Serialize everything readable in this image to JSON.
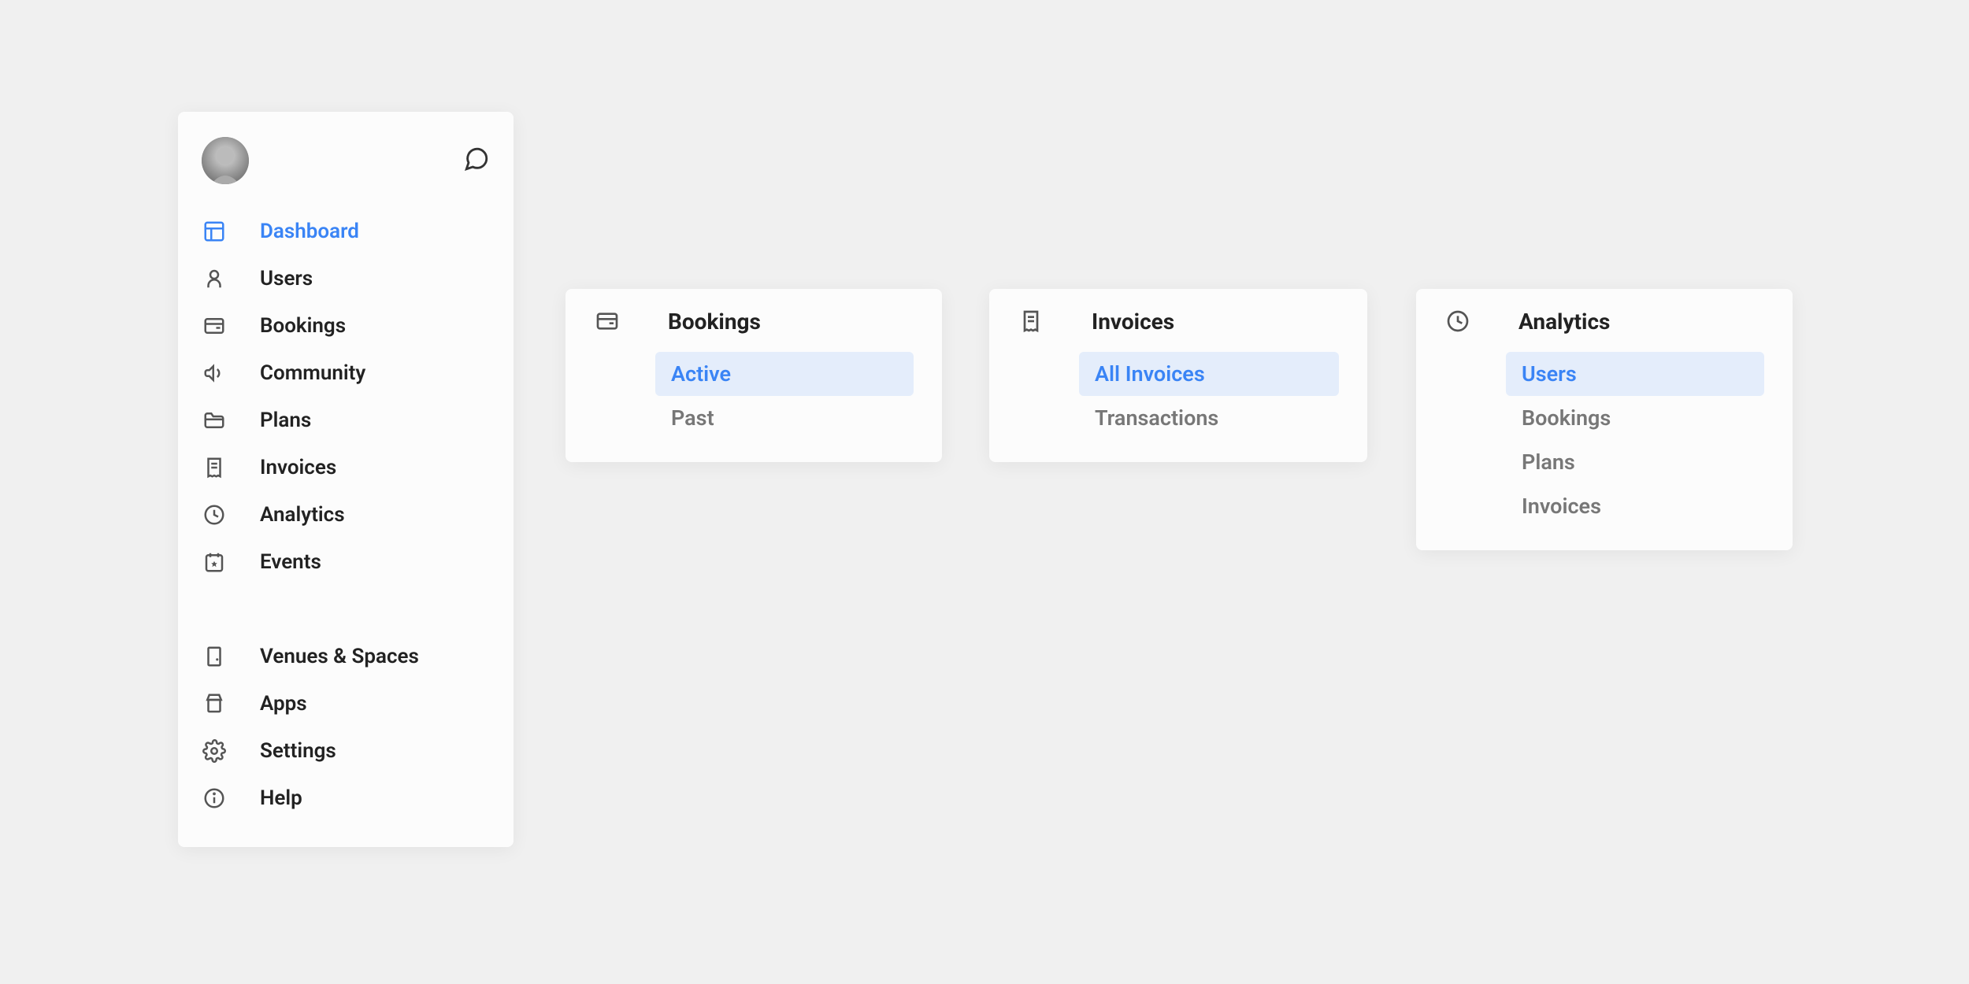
{
  "sidebar": {
    "items": [
      {
        "label": "Dashboard",
        "active": true,
        "icon": "layout"
      },
      {
        "label": "Users",
        "active": false,
        "icon": "user"
      },
      {
        "label": "Bookings",
        "active": false,
        "icon": "calendar-card"
      },
      {
        "label": "Community",
        "active": false,
        "icon": "megaphone"
      },
      {
        "label": "Plans",
        "active": false,
        "icon": "folder"
      },
      {
        "label": "Invoices",
        "active": false,
        "icon": "receipt"
      },
      {
        "label": "Analytics",
        "active": false,
        "icon": "clock"
      },
      {
        "label": "Events",
        "active": false,
        "icon": "event"
      }
    ],
    "secondary": [
      {
        "label": "Venues & Spaces",
        "icon": "building"
      },
      {
        "label": "Apps",
        "icon": "store"
      },
      {
        "label": "Settings",
        "icon": "gear"
      },
      {
        "label": "Help",
        "icon": "info"
      }
    ]
  },
  "cards": {
    "bookings": {
      "title": "Bookings",
      "items": [
        {
          "label": "Active",
          "active": true
        },
        {
          "label": "Past",
          "active": false
        }
      ]
    },
    "invoices": {
      "title": "Invoices",
      "items": [
        {
          "label": "All Invoices",
          "active": true
        },
        {
          "label": "Transactions",
          "active": false
        }
      ]
    },
    "analytics": {
      "title": "Analytics",
      "items": [
        {
          "label": "Users",
          "active": true
        },
        {
          "label": "Bookings",
          "active": false
        },
        {
          "label": "Plans",
          "active": false
        },
        {
          "label": "Invoices",
          "active": false
        }
      ]
    }
  }
}
